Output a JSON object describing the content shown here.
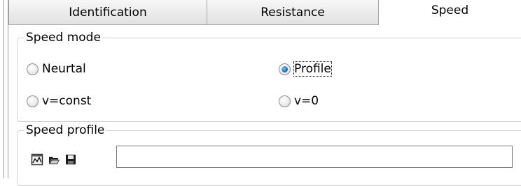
{
  "tabs": [
    {
      "label": "Identification",
      "active": false
    },
    {
      "label": "Resistance",
      "active": false
    },
    {
      "label": "Speed",
      "active": true
    }
  ],
  "speed_mode": {
    "title": "Speed mode",
    "options": [
      {
        "label": "Neurtal",
        "checked": false
      },
      {
        "label": "Profile",
        "checked": true
      },
      {
        "label": "v=const",
        "checked": false
      },
      {
        "label": "v=0",
        "checked": false
      }
    ]
  },
  "speed_profile": {
    "title": "Speed profile",
    "icons": [
      "chart-icon",
      "open-folder-icon",
      "save-icon"
    ],
    "path_value": ""
  },
  "colors": {
    "accent": "#1a73c9",
    "border": "#d3d3d3",
    "tab_border": "#a5a5a5"
  }
}
